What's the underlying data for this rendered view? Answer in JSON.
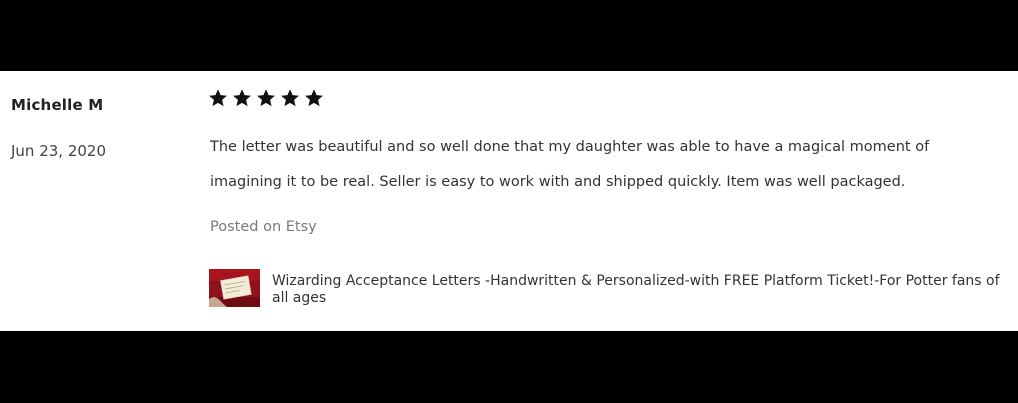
{
  "review": {
    "reviewer_name": "Michelle M",
    "date": "Jun 23, 2020",
    "rating": 5,
    "rating_max": 5,
    "text": "The letter was beautiful and so well done that my daughter was able to have a magical moment of imagining it to be real. Seller is easy to work with and shipped quickly. Item was well packaged.",
    "posted_on": "Posted on Etsy",
    "item": {
      "title": "Wizarding Acceptance Letters -Handwritten & Personalized-with FREE Platform Ticket!-For Potter fans of all ages",
      "thumbnail_icon": "letter-thumbnail"
    }
  },
  "colors": {
    "letterbox": "#000000",
    "panel": "#ffffff",
    "star": "#111111",
    "text": "#333333",
    "muted": "#7a7a7a",
    "thumbnail_red": "#8f1119"
  }
}
